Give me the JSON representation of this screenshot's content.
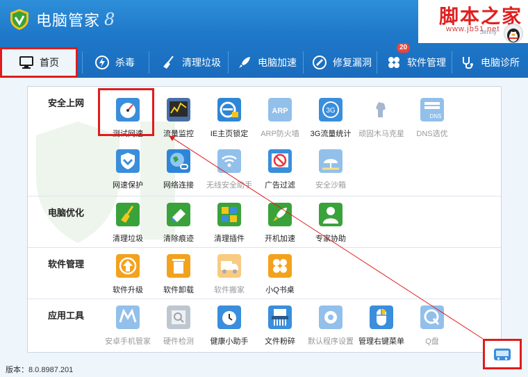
{
  "header": {
    "title": "电脑管家",
    "mark": "8",
    "user_name": "Jenny"
  },
  "watermark": {
    "title": "脚本之家",
    "url": "www.jb51.net"
  },
  "nav": {
    "items": [
      {
        "label": "首页",
        "icon": "monitor-icon"
      },
      {
        "label": "杀毒",
        "icon": "lightning-shield-icon"
      },
      {
        "label": "清理垃圾",
        "icon": "broom-icon"
      },
      {
        "label": "电脑加速",
        "icon": "rocket-icon"
      },
      {
        "label": "修复漏洞",
        "icon": "patch-icon"
      },
      {
        "label": "软件管理",
        "icon": "apps-icon",
        "badge": "20"
      },
      {
        "label": "电脑诊所",
        "icon": "stethoscope-icon"
      }
    ]
  },
  "sections": [
    {
      "title": "安全上网",
      "tools": [
        {
          "label": "测试网速",
          "icon": "speedometer-icon",
          "dim": false
        },
        {
          "label": "流量监控",
          "icon": "chart-monitor-icon",
          "dim": false
        },
        {
          "label": "IE主页锁定",
          "icon": "ie-lock-icon",
          "dim": false
        },
        {
          "label": "ARP防火墙",
          "icon": "arp-icon",
          "dim": true
        },
        {
          "label": "3G流量统计",
          "icon": "3g-icon",
          "dim": false
        },
        {
          "label": "顽固木马克星",
          "icon": "trojan-horse-icon",
          "dim": true
        },
        {
          "label": "DNS选优",
          "icon": "dns-icon",
          "dim": true
        },
        {
          "label": "网速保护",
          "icon": "shield-check-icon",
          "dim": false
        },
        {
          "label": "网络连接",
          "icon": "globe-link-icon",
          "dim": false
        },
        {
          "label": "无线安全助手",
          "icon": "wifi-icon",
          "dim": true
        },
        {
          "label": "广告过滤",
          "icon": "ad-filter-icon",
          "dim": false
        },
        {
          "label": "安全沙箱",
          "icon": "sandbox-icon",
          "dim": true
        }
      ]
    },
    {
      "title": "电脑优化",
      "tools": [
        {
          "label": "清理垃圾",
          "icon": "broom-icon",
          "dim": false
        },
        {
          "label": "清除痕迹",
          "icon": "eraser-icon",
          "dim": false
        },
        {
          "label": "清理插件",
          "icon": "puzzle-icon",
          "dim": false
        },
        {
          "label": "开机加速",
          "icon": "rocket-icon",
          "dim": false
        },
        {
          "label": "专家协助",
          "icon": "expert-icon",
          "dim": false
        }
      ]
    },
    {
      "title": "软件管理",
      "tools": [
        {
          "label": "软件升级",
          "icon": "upgrade-icon",
          "dim": false
        },
        {
          "label": "软件卸载",
          "icon": "trash-icon",
          "dim": false
        },
        {
          "label": "软件搬家",
          "icon": "truck-icon",
          "dim": true
        },
        {
          "label": "小Q书桌",
          "icon": "clover-icon",
          "dim": false
        }
      ]
    },
    {
      "title": "应用工具",
      "tools": [
        {
          "label": "安卓手机管家",
          "icon": "android-manager-icon",
          "dim": true
        },
        {
          "label": "硬件检测",
          "icon": "hardware-icon",
          "dim": true
        },
        {
          "label": "健康小助手",
          "icon": "alarm-clock-icon",
          "dim": false
        },
        {
          "label": "文件粉碎",
          "icon": "shredder-icon",
          "dim": false
        },
        {
          "label": "默认程序设置",
          "icon": "gear-icon",
          "dim": true
        },
        {
          "label": "管理右键菜单",
          "icon": "mouse-icon",
          "dim": false
        },
        {
          "label": "Q盘",
          "icon": "qdisk-icon",
          "dim": true
        }
      ]
    }
  ],
  "footer": {
    "version": "版本：8.0.8987.201"
  },
  "colors": {
    "header_top": "#2e8fd9",
    "header_bottom": "#1a6cbd",
    "highlight": "#e01b1b",
    "accent_orange": "#f3a21d",
    "accent_blue": "#3a8edb"
  }
}
